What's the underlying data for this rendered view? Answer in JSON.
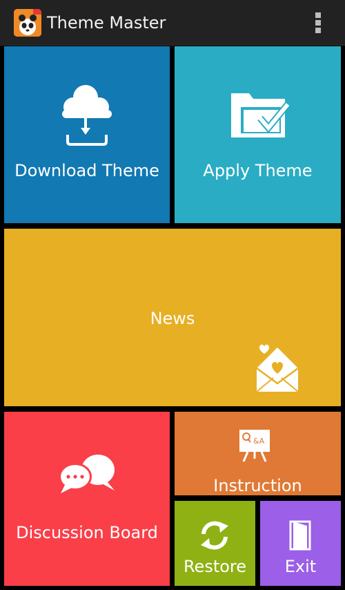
{
  "app_bar": {
    "title": "Theme Master",
    "app_icon": "panda-app-icon",
    "menu_icon": "overflow-menu-icon"
  },
  "tiles": {
    "download": {
      "label": "Download Theme",
      "icon": "cloud-download-icon",
      "color": "#1279b2"
    },
    "apply": {
      "label": "Apply Theme",
      "icon": "folder-check-icon",
      "color": "#2aacc4"
    },
    "news": {
      "label": "News",
      "icon": "love-letter-icon",
      "color": "#e7af24"
    },
    "discussion": {
      "label": "Discussion Board",
      "icon": "chat-bubbles-icon",
      "color": "#fa3f49"
    },
    "instruction": {
      "label": "Instruction",
      "icon": "qa-board-icon",
      "color": "#e07935"
    },
    "restore": {
      "label": "Restore",
      "icon": "refresh-icon",
      "color": "#8fb114"
    },
    "exit": {
      "label": "Exit",
      "icon": "door-exit-icon",
      "color": "#9c5fe7"
    }
  }
}
